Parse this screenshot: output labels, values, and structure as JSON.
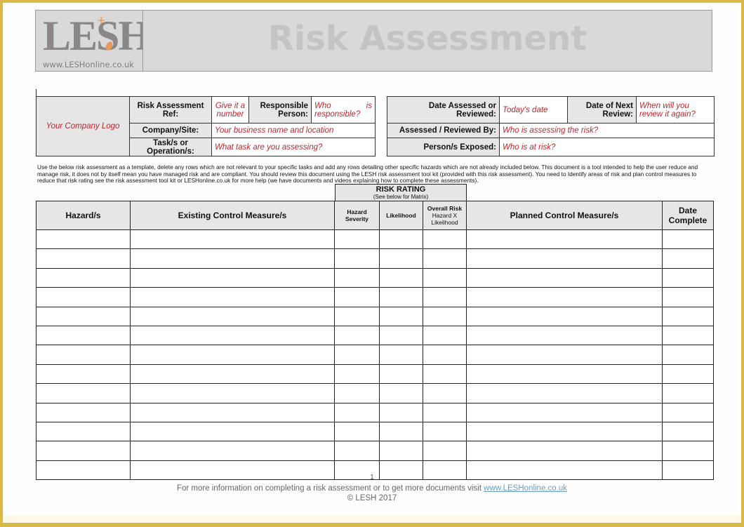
{
  "header": {
    "logo_text": "LESH",
    "logo_plus": "+",
    "logo_url": "www.LESHonline.co.uk",
    "title": "Risk Assessment"
  },
  "info_left": {
    "logo_placeholder": "Your Company Logo",
    "ref_label": "Risk Assessment Ref:",
    "ref_value": "Give it a number",
    "responsible_label": "Responsible Person:",
    "responsible_value": "Who is responsible?",
    "company_label": "Company/Site:",
    "company_value": "Your business name and location",
    "task_label": "Task/s or Operation/s:",
    "task_value": "What task are you assessing?"
  },
  "info_right": {
    "date_assessed_label": "Date Assessed or Reviewed:",
    "date_assessed_value": "Today's date",
    "next_review_label": "Date of Next Review:",
    "next_review_value": "When will you review it again?",
    "reviewed_by_label": "Assessed / Reviewed By:",
    "reviewed_by_value": "Who is assessing the risk?",
    "exposed_label": "Person/s Exposed:",
    "exposed_value": "Who is at risk?"
  },
  "instructions": "Use the below risk assessment as a template, delete any rows which are not relevant to your specific tasks and add any rows detailing other specific hazards which are not already included below. This document is a tool intended to help the user reduce and manage risk, it does not by itself mean you have managed risk and are compliant. You should review this document using the LESH risk assessment tool kit (provided with this risk assessment). You need to Identify areas of risk and plan control measures to reduce that risk rating see the risk assessment tool kit or LESHonline.co.uk for more help (we have documents and videos explaining how to complete these assessments).",
  "risk_rating": {
    "title": "RISK RATING",
    "subtitle": "(See below for Matrix)"
  },
  "table": {
    "columns": {
      "hazard": "Hazard/s",
      "existing": "Existing Control Measure/s",
      "severity": "Hazard Severity",
      "likelihood": "Likelihood",
      "overall_title": "Overall Risk",
      "overall_sub": "Hazard X Likelihood",
      "planned": "Planned Control Measure/s",
      "date": "Date Complete"
    },
    "row_count": 13
  },
  "footer": {
    "page_number": "1",
    "info_text": "For more information on completing a risk assessment or to get more documents visit ",
    "link_text": "www.LESHonline.co.uk",
    "copyright": "© LESH 2017"
  }
}
